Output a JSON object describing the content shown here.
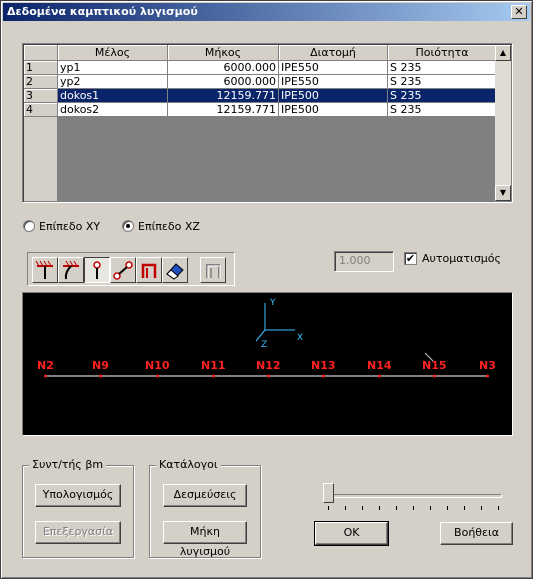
{
  "window": {
    "title": "Δεδομένα καμπτικού λυγισμού",
    "close_glyph": "✕"
  },
  "table": {
    "columns": [
      "Μέλος",
      "Μήκος",
      "Διατομή",
      "Ποιότητα"
    ],
    "rows": [
      {
        "index": "1",
        "member": "yp1",
        "length": "6000.000",
        "section": "IPE550",
        "quality": "S 235",
        "selected": false
      },
      {
        "index": "2",
        "member": "yp2",
        "length": "6000.000",
        "section": "IPE550",
        "quality": "S 235",
        "selected": false
      },
      {
        "index": "3",
        "member": "dokos1",
        "length": "12159.771",
        "section": "IPE500",
        "quality": "S 235",
        "selected": true
      },
      {
        "index": "4",
        "member": "dokos2",
        "length": "12159.771",
        "section": "IPE500",
        "quality": "S 235",
        "selected": false
      }
    ]
  },
  "planes": {
    "xy_label": "Επίπεδο XY",
    "xz_label": "Επίπεδο XZ",
    "selected": "xz"
  },
  "toolbar": {
    "icons": [
      "fixed-support-icon",
      "pinned-support-icon",
      "hinge-icon",
      "double-hinge-icon",
      "portal-icon",
      "eraser-icon",
      "portal-disabled-icon"
    ],
    "pressed_index": 2
  },
  "factor": {
    "value": "1.000",
    "auto_label": "Αυτοματισμός",
    "auto_checked": true,
    "check_glyph": "✔"
  },
  "viewport": {
    "axis_labels": {
      "y": "Y",
      "x": "X",
      "z": "Z"
    },
    "nodes": [
      "N2",
      "N9",
      "N10",
      "N11",
      "N12",
      "N13",
      "N14",
      "N15",
      "N3"
    ],
    "node_color": "#ff2020",
    "axis_color": "#40c0ff"
  },
  "beta_group": {
    "legend": "Συντ/τής βm",
    "calc_label": "Υπολογισμός",
    "edit_label": "Επεξεργασία"
  },
  "lists_group": {
    "legend": "Κατάλογοι",
    "constraints_label": "Δεσμεύσεις",
    "lengths_label": "Μήκη λυγισμού"
  },
  "slider": {
    "value_fraction": 0.0
  },
  "buttons": {
    "ok_label": "OK",
    "help_label": "Βοήθεια"
  }
}
